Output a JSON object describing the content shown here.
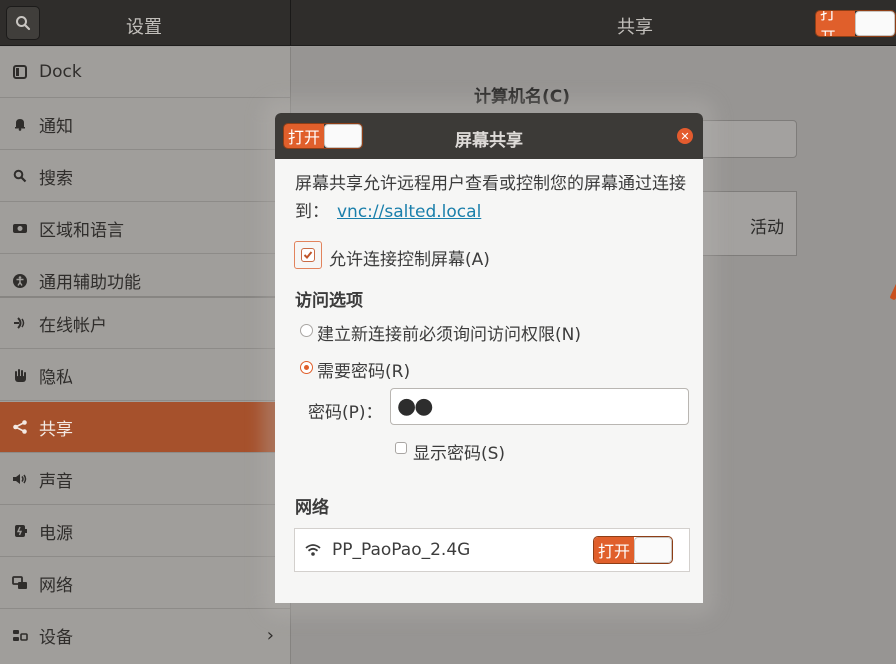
{
  "header": {
    "left_title": "设置",
    "right_title": "共享",
    "toggle_label": "打开"
  },
  "sidebar": {
    "items": [
      {
        "label": "Dock",
        "icon": "dock-icon"
      },
      {
        "label": "通知",
        "icon": "bell-icon"
      },
      {
        "label": "搜索",
        "icon": "search-icon"
      },
      {
        "label": "区域和语言",
        "icon": "camera-icon"
      },
      {
        "label": "通用辅助功能",
        "icon": "accessibility-icon"
      },
      {
        "label": "在线帐户",
        "icon": "online-accounts-icon"
      },
      {
        "label": "隐私",
        "icon": "hand-icon"
      },
      {
        "label": "共享",
        "icon": "share-icon",
        "active": true
      },
      {
        "label": "声音",
        "icon": "speaker-icon"
      },
      {
        "label": "电源",
        "icon": "power-icon"
      },
      {
        "label": "网络",
        "icon": "network-icon"
      },
      {
        "label": "设备",
        "icon": "devices-icon",
        "chevron": "›"
      }
    ]
  },
  "main": {
    "computer_name_label": "计算机名(C)",
    "status_active": "活动"
  },
  "dialog": {
    "title": "屏幕共享",
    "toggle_label": "打开",
    "description": "屏幕共享允许远程用户查看或控制您的屏幕通过连接到：",
    "link": "vnc://salted.local",
    "allow_control_label": "允许连接控制屏幕(A)",
    "access_section": "访问选项",
    "radio_ask": "建立新连接前必须询问访问权限(N)",
    "radio_password": "需要密码(R)",
    "password_label": "密码(P)：",
    "password_value": "●●",
    "show_password_label": "显示密码(S)",
    "network_section": "网络",
    "network_name": "PP_PaoPao_2.4G",
    "network_toggle_label": "打开"
  },
  "colors": {
    "accent": "#e05f2b",
    "active_item": "#a6512c",
    "header_bg": "#2f2d2b",
    "link": "#1a7fab"
  }
}
